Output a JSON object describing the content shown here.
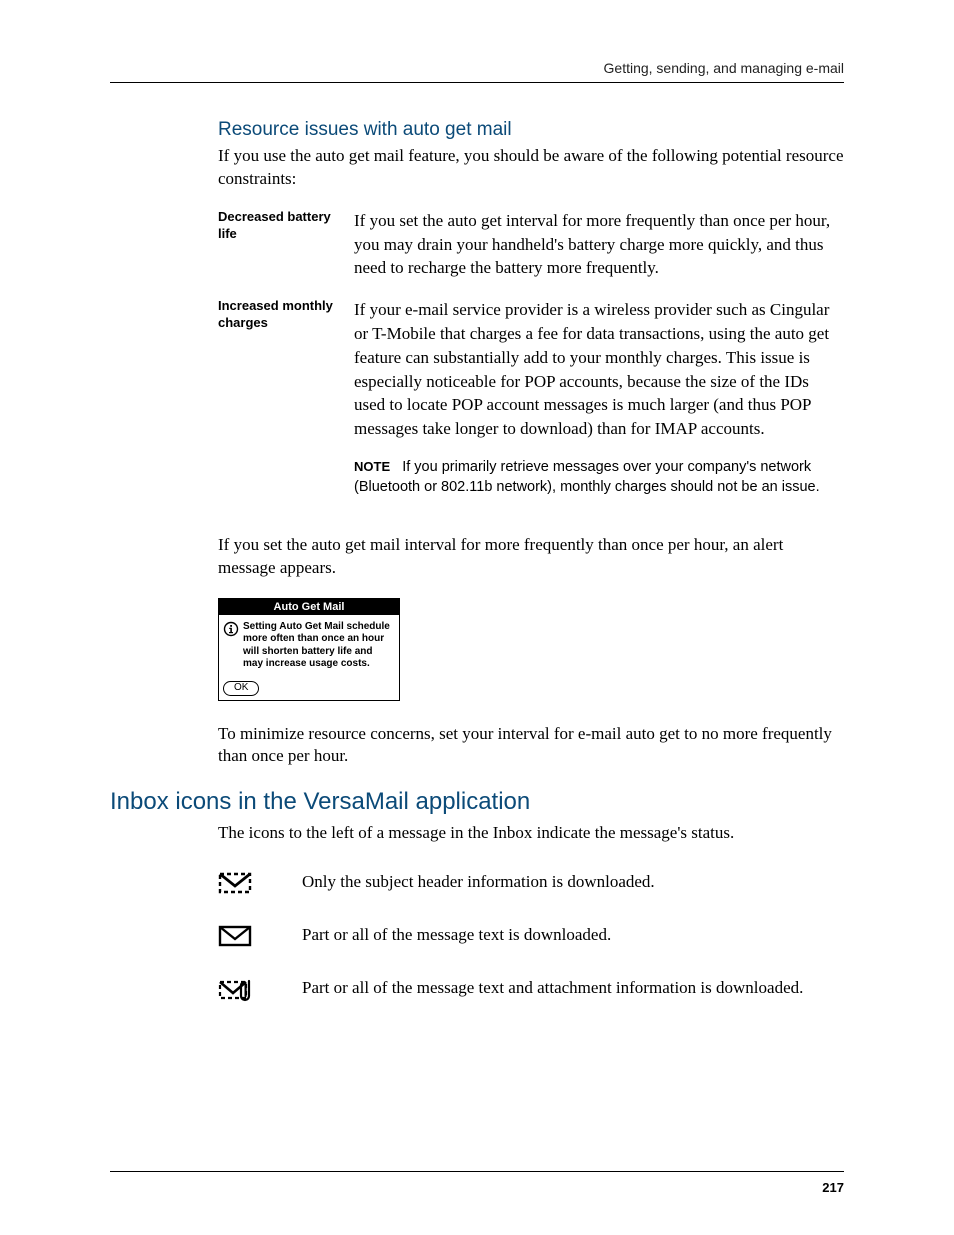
{
  "page": {
    "running_head": "Getting, sending, and managing e-mail",
    "page_number": "217"
  },
  "section_resource": {
    "heading": "Resource issues with auto get mail",
    "intro": "If you use the auto get mail feature, you should be aware of the following potential resource constraints:",
    "defs": [
      {
        "term": "Decreased battery life",
        "desc": "If you set the auto get interval for more frequently than once per hour, you may drain your handheld's battery charge more quickly, and thus need to recharge the battery more frequently."
      },
      {
        "term": "Increased monthly charges",
        "desc": "If your e-mail service provider is a wireless provider such as Cingular or T-Mobile that charges a fee for data transactions, using the auto get feature can substantially add to your monthly charges. This issue is especially noticeable for POP accounts, because the size of the IDs used to locate POP account messages is much larger (and thus POP messages take longer to download) than for IMAP accounts."
      }
    ],
    "note_label": "NOTE",
    "note_text": "If you primarily retrieve messages over your company's network (Bluetooth or 802.11b network), monthly charges should not be an issue.",
    "alert_intro": "If you set the auto get mail interval for more frequently than once per hour, an alert message appears.",
    "dialog": {
      "title": "Auto Get Mail",
      "message": "Setting Auto Get Mail schedule more often than once an hour will shorten battery life and may increase usage costs.",
      "ok_label": "OK"
    },
    "outro": "To minimize resource concerns, set your interval for e-mail auto get to no more frequently than once per hour."
  },
  "section_icons": {
    "heading": "Inbox icons in the VersaMail application",
    "intro": "The icons to the left of a message in the Inbox indicate the message's status.",
    "rows": [
      {
        "icon": "dashed-envelope-icon",
        "desc": "Only the subject header information is downloaded."
      },
      {
        "icon": "envelope-icon",
        "desc": "Part or all of the message text is downloaded."
      },
      {
        "icon": "envelope-attach-icon",
        "desc": "Part or all of the message text and attachment information is downloaded."
      }
    ]
  }
}
